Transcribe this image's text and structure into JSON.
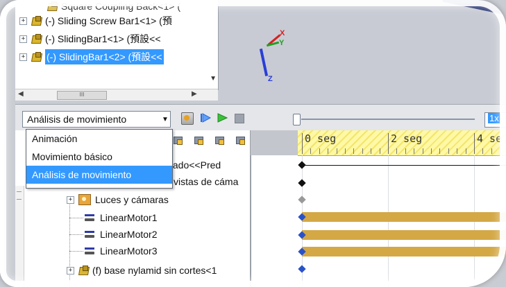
{
  "feature_tree_top": {
    "rows": [
      {
        "expander": "",
        "label": "Square Coupling Back<1> (",
        "selected": false
      },
      {
        "expander": "+",
        "label": "(-) Sliding Screw Bar1<1> (預",
        "selected": false
      },
      {
        "expander": "+",
        "label": "(-) SlidingBar1<1> (預設<<",
        "selected": false
      },
      {
        "expander": "+",
        "label": "(-) SlidingBar1<2> (預設<<",
        "selected": true
      }
    ],
    "hscroll_thumb": "III"
  },
  "triad": {
    "x": "X",
    "y": "Y",
    "z": "Z"
  },
  "motion_toolbar": {
    "study_type_selected": "Análisis de movimiento",
    "playback_speed": "1x"
  },
  "study_type_dropdown": {
    "options": [
      {
        "label": "Animación",
        "active": false
      },
      {
        "label": "Movimiento básico",
        "active": false
      },
      {
        "label": "Análisis de movimiento",
        "active": true
      }
    ]
  },
  "motion_tree": {
    "rows": [
      {
        "label": "inado<<Pred",
        "icon": "none"
      },
      {
        "label": "vistas de cáma",
        "icon": "none"
      },
      {
        "label": "Luces y cámaras",
        "icon": "camera-folder"
      },
      {
        "label": "LinearMotor1",
        "icon": "linear-motor"
      },
      {
        "label": "LinearMotor2",
        "icon": "linear-motor"
      },
      {
        "label": "LinearMotor3",
        "icon": "linear-motor"
      },
      {
        "label": "(f) base nylamid sin cortes<1",
        "icon": "part"
      }
    ]
  },
  "timeline": {
    "ticks": [
      "0 seg",
      "2 seg",
      "4 se"
    ]
  },
  "colors": {
    "selection": "#3399ff",
    "timebar": "#d4a845",
    "ruler": "#f3e66a"
  }
}
